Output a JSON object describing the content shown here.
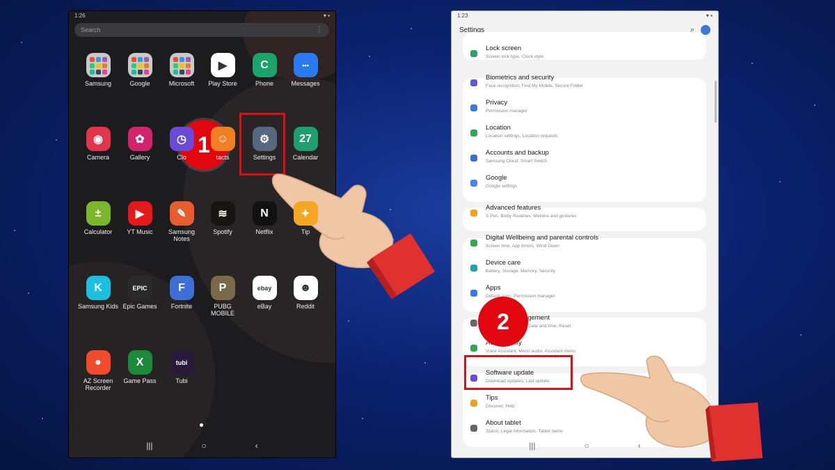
{
  "left_screen": {
    "status_time": "1:26",
    "search_placeholder": "Search",
    "apps": [
      {
        "label": "Samsung",
        "icon": "samsung-folder-icon",
        "color": "#c9c9c9"
      },
      {
        "label": "Google",
        "icon": "google-folder-icon",
        "color": "#c9c9c9"
      },
      {
        "label": "Microsoft",
        "icon": "microsoft-folder-icon",
        "color": "#c9c9c9"
      },
      {
        "label": "Play Store",
        "icon": "play-store-icon",
        "color": "#ffffff"
      },
      {
        "label": "Phone",
        "icon": "phone-icon",
        "color": "#1aa36b"
      },
      {
        "label": "Messages",
        "icon": "messages-icon",
        "color": "#2b7bf0"
      },
      {
        "label": "Camera",
        "icon": "camera-icon",
        "color": "#e2344d"
      },
      {
        "label": "Gallery",
        "icon": "gallery-icon",
        "color": "#d2246b"
      },
      {
        "label": "Clo",
        "icon": "clock-icon",
        "color": "#6a4bd8"
      },
      {
        "label": "tacts",
        "icon": "contacts-icon",
        "color": "#f07f24"
      },
      {
        "label": "Settings",
        "icon": "settings-gear-icon",
        "color": "#556880"
      },
      {
        "label": "Calendar",
        "icon": "calendar-icon",
        "color": "#1f9e6f"
      },
      {
        "label": "Calculator",
        "icon": "calculator-icon",
        "color": "#7ab72a"
      },
      {
        "label": "YT Music",
        "icon": "yt-music-icon",
        "color": "#e41919"
      },
      {
        "label": "Samsung Notes",
        "icon": "samsung-notes-icon",
        "color": "#e85d2e"
      },
      {
        "label": "Spotify",
        "icon": "spotify-icon",
        "color": "#191414"
      },
      {
        "label": "Netflix",
        "icon": "netflix-icon",
        "color": "#111111"
      },
      {
        "label": "Tip",
        "icon": "tips-icon",
        "color": "#f5a623"
      },
      {
        "label": "Samsung Kids",
        "icon": "samsung-kids-icon",
        "color": "#1cbfe0"
      },
      {
        "label": "Epic Games",
        "icon": "epic-games-icon",
        "color": "#2a2a2a"
      },
      {
        "label": "Fortnite",
        "icon": "fortnite-icon",
        "color": "#3c6fd8"
      },
      {
        "label": "PUBG MOBILE",
        "icon": "pubg-icon",
        "color": "#7a6a4a"
      },
      {
        "label": "eBay",
        "icon": "ebay-icon",
        "color": "#ffffff"
      },
      {
        "label": "Reddit",
        "icon": "reddit-icon",
        "color": "#ffffff"
      },
      {
        "label": "AZ Screen Recorder",
        "icon": "az-recorder-icon",
        "color": "#ef4b2c"
      },
      {
        "label": "Game Pass",
        "icon": "game-pass-icon",
        "color": "#1b8a3a"
      },
      {
        "label": "Tubi",
        "icon": "tubi-icon",
        "color": "#2a1a3a"
      }
    ],
    "icon_glyphs": {
      "Play Store": "▶",
      "Phone": "C",
      "Messages": "•••",
      "Camera": "◉",
      "Gallery": "✿",
      "Clo": "◷",
      "tacts": "☺",
      "Settings": "⚙",
      "Calendar": "27",
      "Calculator": "±",
      "YT Music": "▶",
      "Samsung Notes": "✎",
      "Spotify": "≋",
      "Netflix": "N",
      "Tip": "✦",
      "Samsung Kids": "K",
      "Epic Games": "EPIC",
      "Fortnite": "F",
      "PUBG MOBILE": "P",
      "eBay": "ebay",
      "Reddit": "☻",
      "AZ Screen Recorder": "●",
      "Game Pass": "X",
      "Tubi": "tubi"
    }
  },
  "right_screen": {
    "status_time": "1:23",
    "title": "Settings",
    "items": [
      {
        "title": "Lock screen",
        "subtitle": "Screen lock type, Clock style",
        "icon": "lock-screen-icon",
        "color": "#2e9e6a"
      },
      {
        "title": "Biometrics and security",
        "subtitle": "Face recognition, Find My Mobile, Secure Folder",
        "icon": "shield-icon",
        "color": "#5b5bd6"
      },
      {
        "title": "Privacy",
        "subtitle": "Permission manager",
        "icon": "privacy-icon",
        "color": "#3a7bd5"
      },
      {
        "title": "Location",
        "subtitle": "Location settings, Location requests",
        "icon": "location-pin-icon",
        "color": "#2fa84f"
      },
      {
        "title": "Accounts and backup",
        "subtitle": "Samsung Cloud, Smart Switch",
        "icon": "key-icon",
        "color": "#3a6fd5"
      },
      {
        "title": "Google",
        "subtitle": "Google settings",
        "icon": "google-g-icon",
        "color": "#4285f4"
      },
      {
        "title": "Advanced features",
        "subtitle": "S Pen, Bixby Routines, Motions and gestures",
        "icon": "gear-plus-icon",
        "color": "#f0a020"
      },
      {
        "title": "Digital Wellbeing and parental controls",
        "subtitle": "Screen time, App timers, Wind Down",
        "icon": "wellbeing-icon",
        "color": "#2fa84f"
      },
      {
        "title": "Device care",
        "subtitle": "Battery, Storage, Memory, Security",
        "icon": "device-care-icon",
        "color": "#1fa3a3"
      },
      {
        "title": "Apps",
        "subtitle": "Default apps, Permission manager",
        "icon": "apps-grid-icon",
        "color": "#3a7bd5"
      },
      {
        "title": "General management",
        "subtitle": "Language and input, Date and time, Reset",
        "icon": "sliders-icon",
        "color": "#666666"
      },
      {
        "title": "Accessibility",
        "subtitle": "Voice Assistant, Mono audio, Assistant menu",
        "icon": "accessibility-icon",
        "color": "#2fa84f"
      },
      {
        "title": "Software update",
        "subtitle": "Download updates, Last update",
        "icon": "software-update-icon",
        "color": "#6a4bd8"
      },
      {
        "title": "Tips",
        "subtitle": "Discover, Help",
        "icon": "lightbulb-icon",
        "color": "#f0a020"
      },
      {
        "title": "About tablet",
        "subtitle": "Status, Legal information, Tablet name",
        "icon": "info-icon",
        "color": "#666666"
      }
    ]
  },
  "steps": {
    "one": "1",
    "two": "2"
  },
  "colors": {
    "highlight": "#e00d12",
    "badge": "#e2060e",
    "hand_skin": "#f0c7a5",
    "cuff": "#e0312f"
  }
}
